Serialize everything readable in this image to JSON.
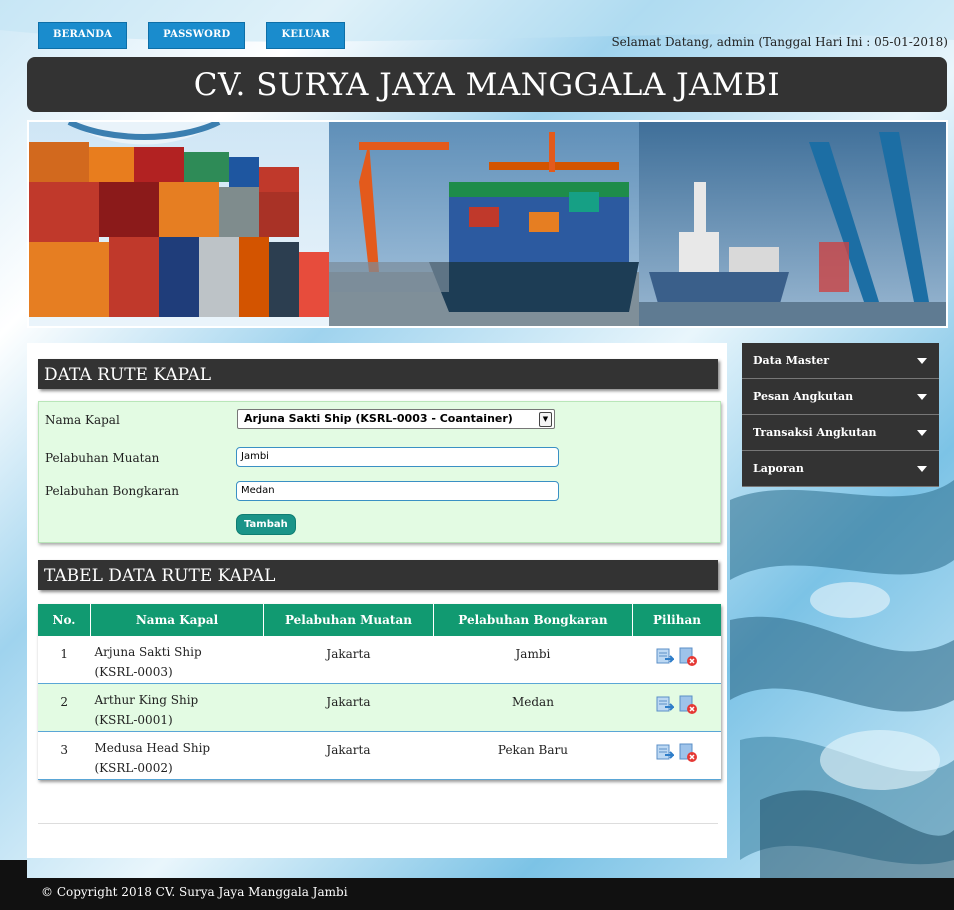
{
  "nav": {
    "beranda": "BERANDA",
    "password": "PASSWORD",
    "keluar": "KELUAR"
  },
  "welcome": "Selamat Datang, admin (Tanggal Hari Ini : 05-01-2018)",
  "site_title": "CV. SURYA JAYA MANGGALA JAMBI",
  "form": {
    "title": "DATA RUTE KAPAL",
    "nama_kapal_label": "Nama Kapal",
    "nama_kapal_value": "Arjuna Sakti Ship (KSRL-0003 - Coantainer)",
    "muatan_label": "Pelabuhan Muatan",
    "muatan_value": "Jambi",
    "bongkaran_label": "Pelabuhan Bongkaran",
    "bongkaran_value": "Medan",
    "submit_label": "Tambah"
  },
  "table": {
    "title": "TABEL DATA RUTE KAPAL",
    "headers": [
      "No.",
      "Nama Kapal",
      "Pelabuhan Muatan",
      "Pelabuhan Bongkaran",
      "Pilihan"
    ],
    "rows": [
      {
        "no": "1",
        "nama": "Arjuna Sakti Ship",
        "kode": "(KSRL-0003)",
        "muatan": "Jakarta",
        "bongkaran": "Jambi"
      },
      {
        "no": "2",
        "nama": "Arthur King Ship",
        "kode": "(KSRL-0001)",
        "muatan": "Jakarta",
        "bongkaran": "Medan"
      },
      {
        "no": "3",
        "nama": "Medusa Head Ship",
        "kode": "(KSRL-0002)",
        "muatan": "Jakarta",
        "bongkaran": "Pekan Baru"
      }
    ]
  },
  "sidebar": {
    "items": [
      {
        "label": "Data Master"
      },
      {
        "label": "Pesan Angkutan"
      },
      {
        "label": "Transaksi Angkutan"
      },
      {
        "label": "Laporan"
      }
    ]
  },
  "footer": "© Copyright 2018 CV. Surya Jaya Manggala Jambi",
  "colors": {
    "nav_button": "#1a8ccd",
    "title_bar": "#333333",
    "table_header": "#119a71",
    "form_bg": "#e3fbe3"
  },
  "icons": {
    "edit": "edit-icon",
    "delete": "delete-icon",
    "dropdown": "chevron-down-icon"
  }
}
